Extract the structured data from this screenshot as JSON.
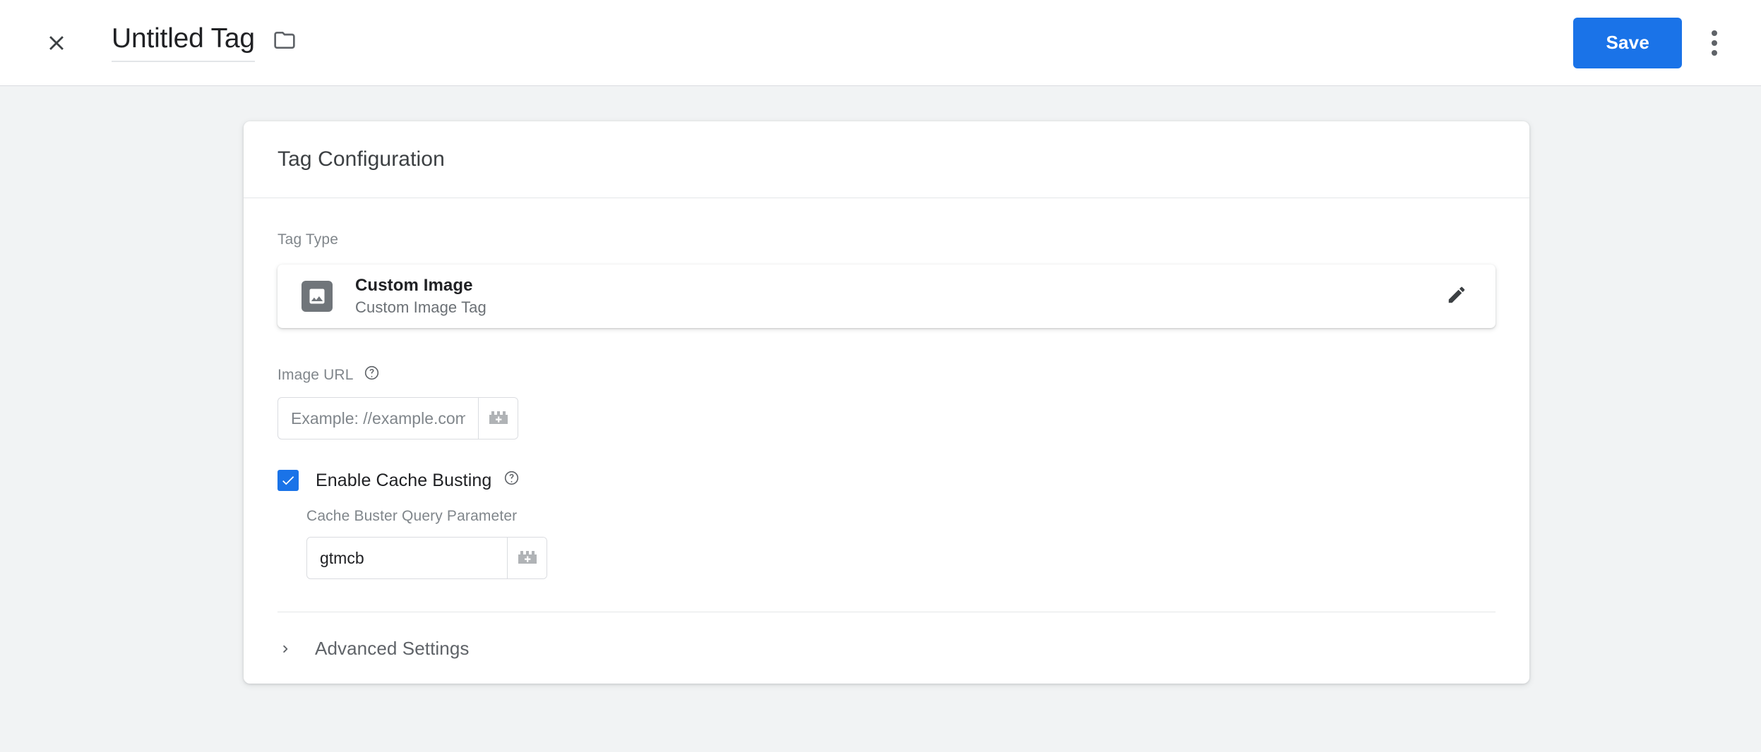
{
  "appbar": {
    "close_icon": "close-icon",
    "title": "Untitled Tag",
    "folder_icon": "folder-icon",
    "save_label": "Save",
    "more_icon": "more-vert-icon",
    "accent_color": "#1a73e8"
  },
  "card": {
    "header_title": "Tag Configuration",
    "tag_type": {
      "label": "Tag Type",
      "icon": "image-icon",
      "name": "Custom Image",
      "description": "Custom Image Tag",
      "edit_icon": "pencil-icon"
    },
    "image_url": {
      "label": "Image URL",
      "help_icon": "help-circle-icon",
      "value": "",
      "placeholder": "Example: //example.com/a.gif",
      "variable_icon": "variable-picker-icon"
    },
    "cache_busting": {
      "label": "Enable Cache Busting",
      "help_icon": "help-circle-icon",
      "checked": true,
      "param_label": "Cache Buster Query Parameter",
      "param_value": "gtmcb",
      "variable_icon": "variable-picker-icon"
    },
    "advanced": {
      "chevron_icon": "chevron-right-icon",
      "label": "Advanced Settings"
    }
  }
}
